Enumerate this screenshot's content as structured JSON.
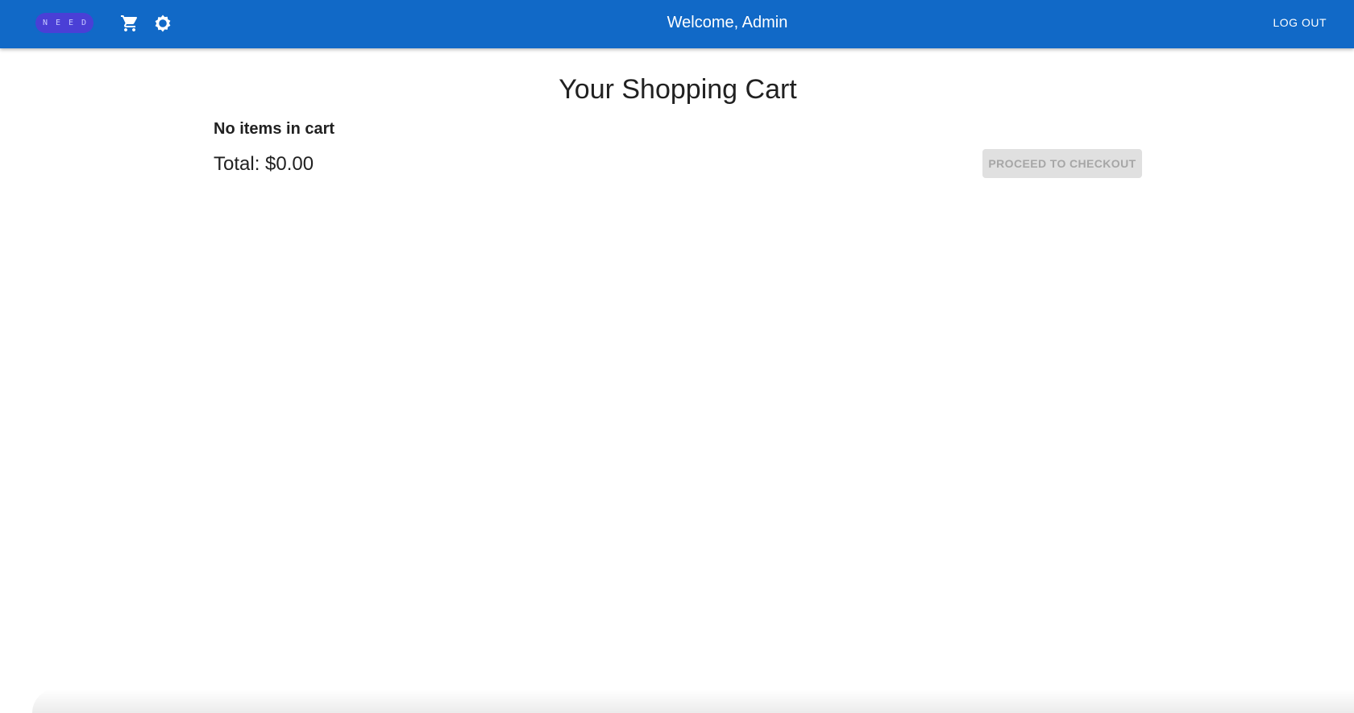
{
  "app": {
    "logo_text": "NEED",
    "colors": {
      "appbar": "#1169c7",
      "logo_bg": "#4a3fd6",
      "button_disabled_bg": "#e0e0e0",
      "button_disabled_text": "#a6a6a6"
    }
  },
  "header": {
    "cart_icon": "shopping-cart-icon",
    "settings_icon": "settings-icon",
    "welcome": "Welcome, Admin",
    "logout_label": "LOG OUT"
  },
  "cart": {
    "title": "Your Shopping Cart",
    "empty_message": "No items in cart",
    "total": "Total: $0.00",
    "checkout_label": "PROCEED TO CHECKOUT",
    "checkout_disabled": true
  }
}
